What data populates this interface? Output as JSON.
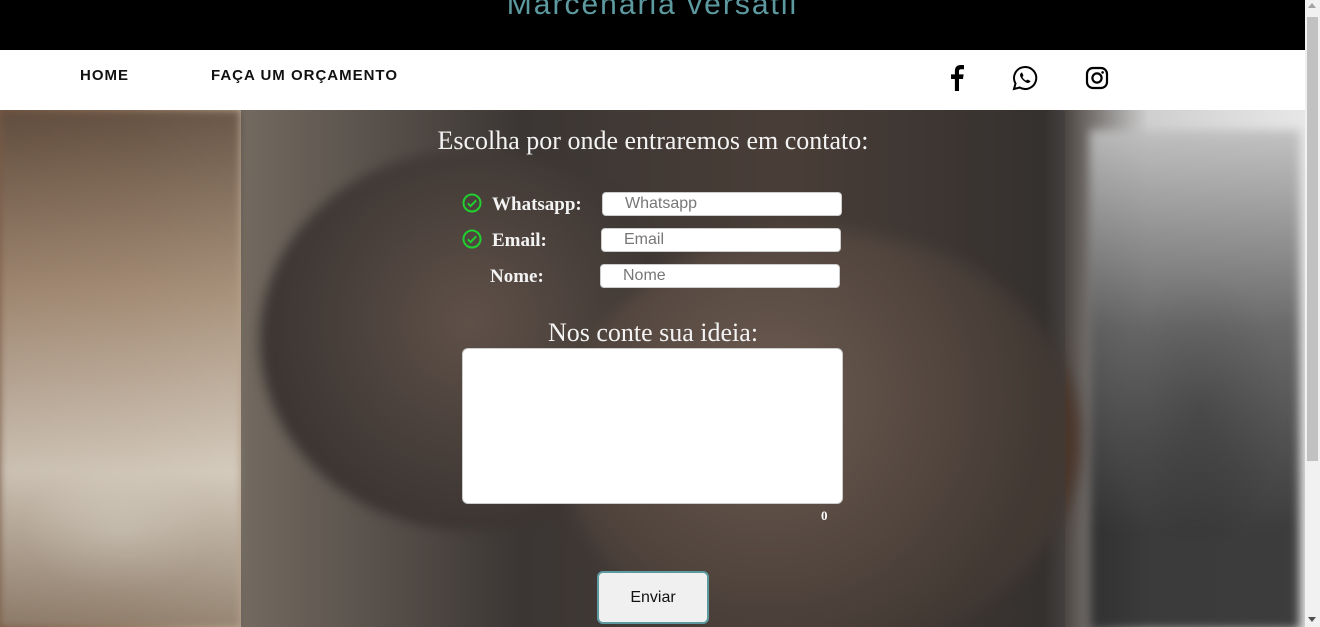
{
  "header": {
    "brand": "Marcenaria versátil"
  },
  "nav": {
    "items": [
      {
        "label": "HOME"
      },
      {
        "label": "FAÇA UM ORÇAMENTO"
      }
    ],
    "social": [
      {
        "icon": "facebook-icon"
      },
      {
        "icon": "whatsapp-icon"
      },
      {
        "icon": "instagram-icon"
      }
    ]
  },
  "form": {
    "heading": "Escolha por onde entraremos em contato:",
    "fields": [
      {
        "label": "Whatsapp:",
        "placeholder": "Whatsapp",
        "checked": true
      },
      {
        "label": "Email:",
        "placeholder": "Email",
        "checked": true
      },
      {
        "label": "Nome:",
        "placeholder": "Nome",
        "checked": false
      }
    ],
    "idea_heading": "Nos conte sua ideia:",
    "char_count": "0",
    "submit_label": "Enviar"
  },
  "colors": {
    "accent": "#5d9aa0",
    "check": "#1fd02e"
  }
}
